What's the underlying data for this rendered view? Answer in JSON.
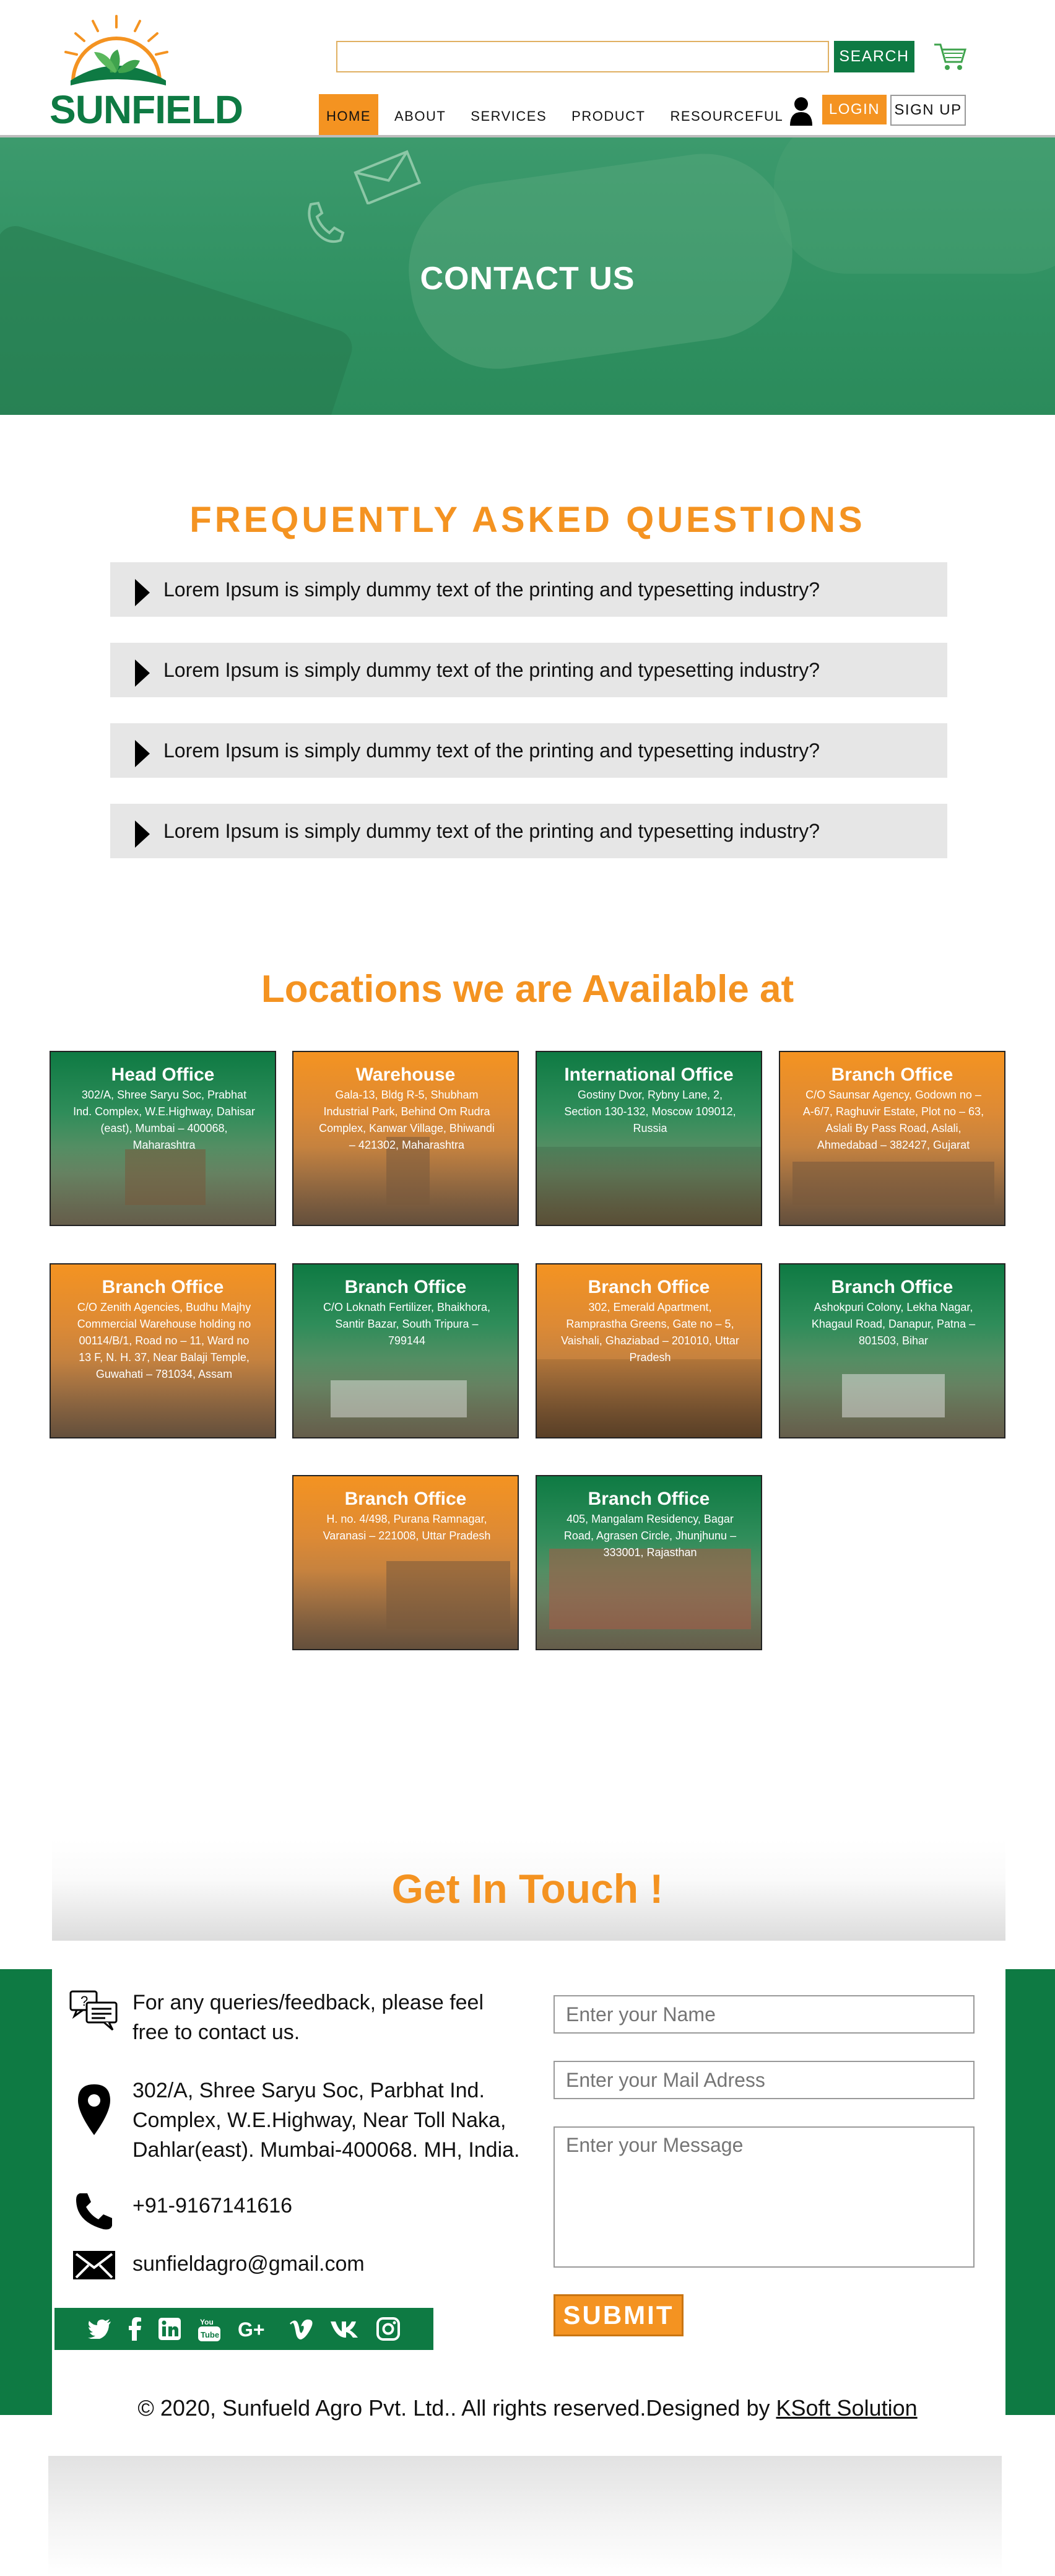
{
  "brand": {
    "name": "SUNFIELD"
  },
  "search": {
    "placeholder": "",
    "button_label": "SEARCH"
  },
  "nav": {
    "items": [
      {
        "label": "HOME"
      },
      {
        "label": "ABOUT"
      },
      {
        "label": "SERVICES"
      },
      {
        "label": "PRODUCT"
      },
      {
        "label": "RESOURCEFUL"
      }
    ],
    "login_label": "LOGIN",
    "signup_label": "SIGN UP"
  },
  "hero": {
    "title": "CONTACT US"
  },
  "faq": {
    "title": "FREQUENTLY ASKED QUESTIONS",
    "items": [
      {
        "question": "Lorem Ipsum is simply dummy text of the printing and typesetting industry?"
      },
      {
        "question": "Lorem Ipsum is simply dummy text of the printing and typesetting industry?"
      },
      {
        "question": "Lorem Ipsum is simply dummy text of the printing and typesetting industry?"
      },
      {
        "question": "Lorem Ipsum is simply dummy text of the printing and typesetting industry?"
      }
    ]
  },
  "locations": {
    "title": "Locations we are Available at",
    "cards": [
      {
        "title": "Head Office",
        "address": "302/A, Shree Saryu Soc, Prabhat Ind. Complex, W.E.Highway, Dahisar (east), Mumbai – 400068, Maharashtra",
        "theme": "green"
      },
      {
        "title": "Warehouse",
        "address": "Gala-13, Bldg R-5, Shubham Industrial Park, Behind Om Rudra Complex, Kanwar Village, Bhiwandi – 421302, Maharashtra",
        "theme": "orange"
      },
      {
        "title": "International Office",
        "address": "Gostiny Dvor, Rybny Lane, 2, Section 130-132, Moscow 109012, Russia",
        "theme": "green"
      },
      {
        "title": "Branch Office",
        "address": "C/O Saunsar Agency, Godown no – A-6/7, Raghuvir Estate, Plot no – 63, Aslali By Pass Road, Aslali, Ahmedabad – 382427, Gujarat",
        "theme": "orange"
      },
      {
        "title": "Branch Office",
        "address": "C/O Zenith Agencies, Budhu Majhy Commercial Warehouse holding no 00114/B/1, Road no – 11, Ward no 13 F, N. H. 37, Near Balaji Temple, Guwahati – 781034, Assam",
        "theme": "orange"
      },
      {
        "title": "Branch Office",
        "address": "C/O Loknath Fertilizer, Bhaikhora, Santir Bazar, South Tripura – 799144",
        "theme": "green"
      },
      {
        "title": "Branch Office",
        "address": "302, Emerald Apartment, Ramprastha Greens, Gate no – 5, Vaishali, Ghaziabad – 201010, Uttar Pradesh",
        "theme": "orange"
      },
      {
        "title": "Branch Office",
        "address": "Ashokpuri Colony, Lekha Nagar, Khagaul Road, Danapur, Patna – 801503, Bihar",
        "theme": "green"
      },
      {
        "title": "Branch Office",
        "address": "H. no. 4/498, Purana Ramnagar, Varanasi – 221008, Uttar Pradesh",
        "theme": "orange"
      },
      {
        "title": "Branch Office",
        "address": "405, Mangalam Residency, Bagar Road, Agrasen Circle, Jhunjhunu – 333001, Rajasthan",
        "theme": "green"
      }
    ]
  },
  "contact": {
    "title": "Get In Touch !",
    "intro": "For any queries/feedback, please feel free to contact us.",
    "address": "302/A, Shree Saryu Soc, Parbhat Ind. Complex, W.E.Highway, Near Toll Naka, Dahlar(east). Mumbai-400068. MH, India.",
    "phone": "+91-9167141616",
    "email": "sunfieldagro@gmail.com",
    "form": {
      "name_placeholder": "Enter your Name",
      "email_placeholder": "Enter your Mail Adress",
      "message_placeholder": "Enter your Message",
      "submit_label": "SUBMIT"
    },
    "social": [
      "twitter-icon",
      "facebook-icon",
      "linkedin-icon",
      "youtube-icon",
      "google-plus-icon",
      "vimeo-icon",
      "vk-icon",
      "instagram-icon"
    ]
  },
  "footer": {
    "text": "© 2020, Sunfueld Agro Pvt. Ltd.. All rights reserved.Designed by ",
    "designer": "KSoft Solution"
  },
  "colors": {
    "brand_green": "#0e7a43",
    "accent_orange": "#f49321",
    "faq_bg": "#e6e6e6"
  }
}
